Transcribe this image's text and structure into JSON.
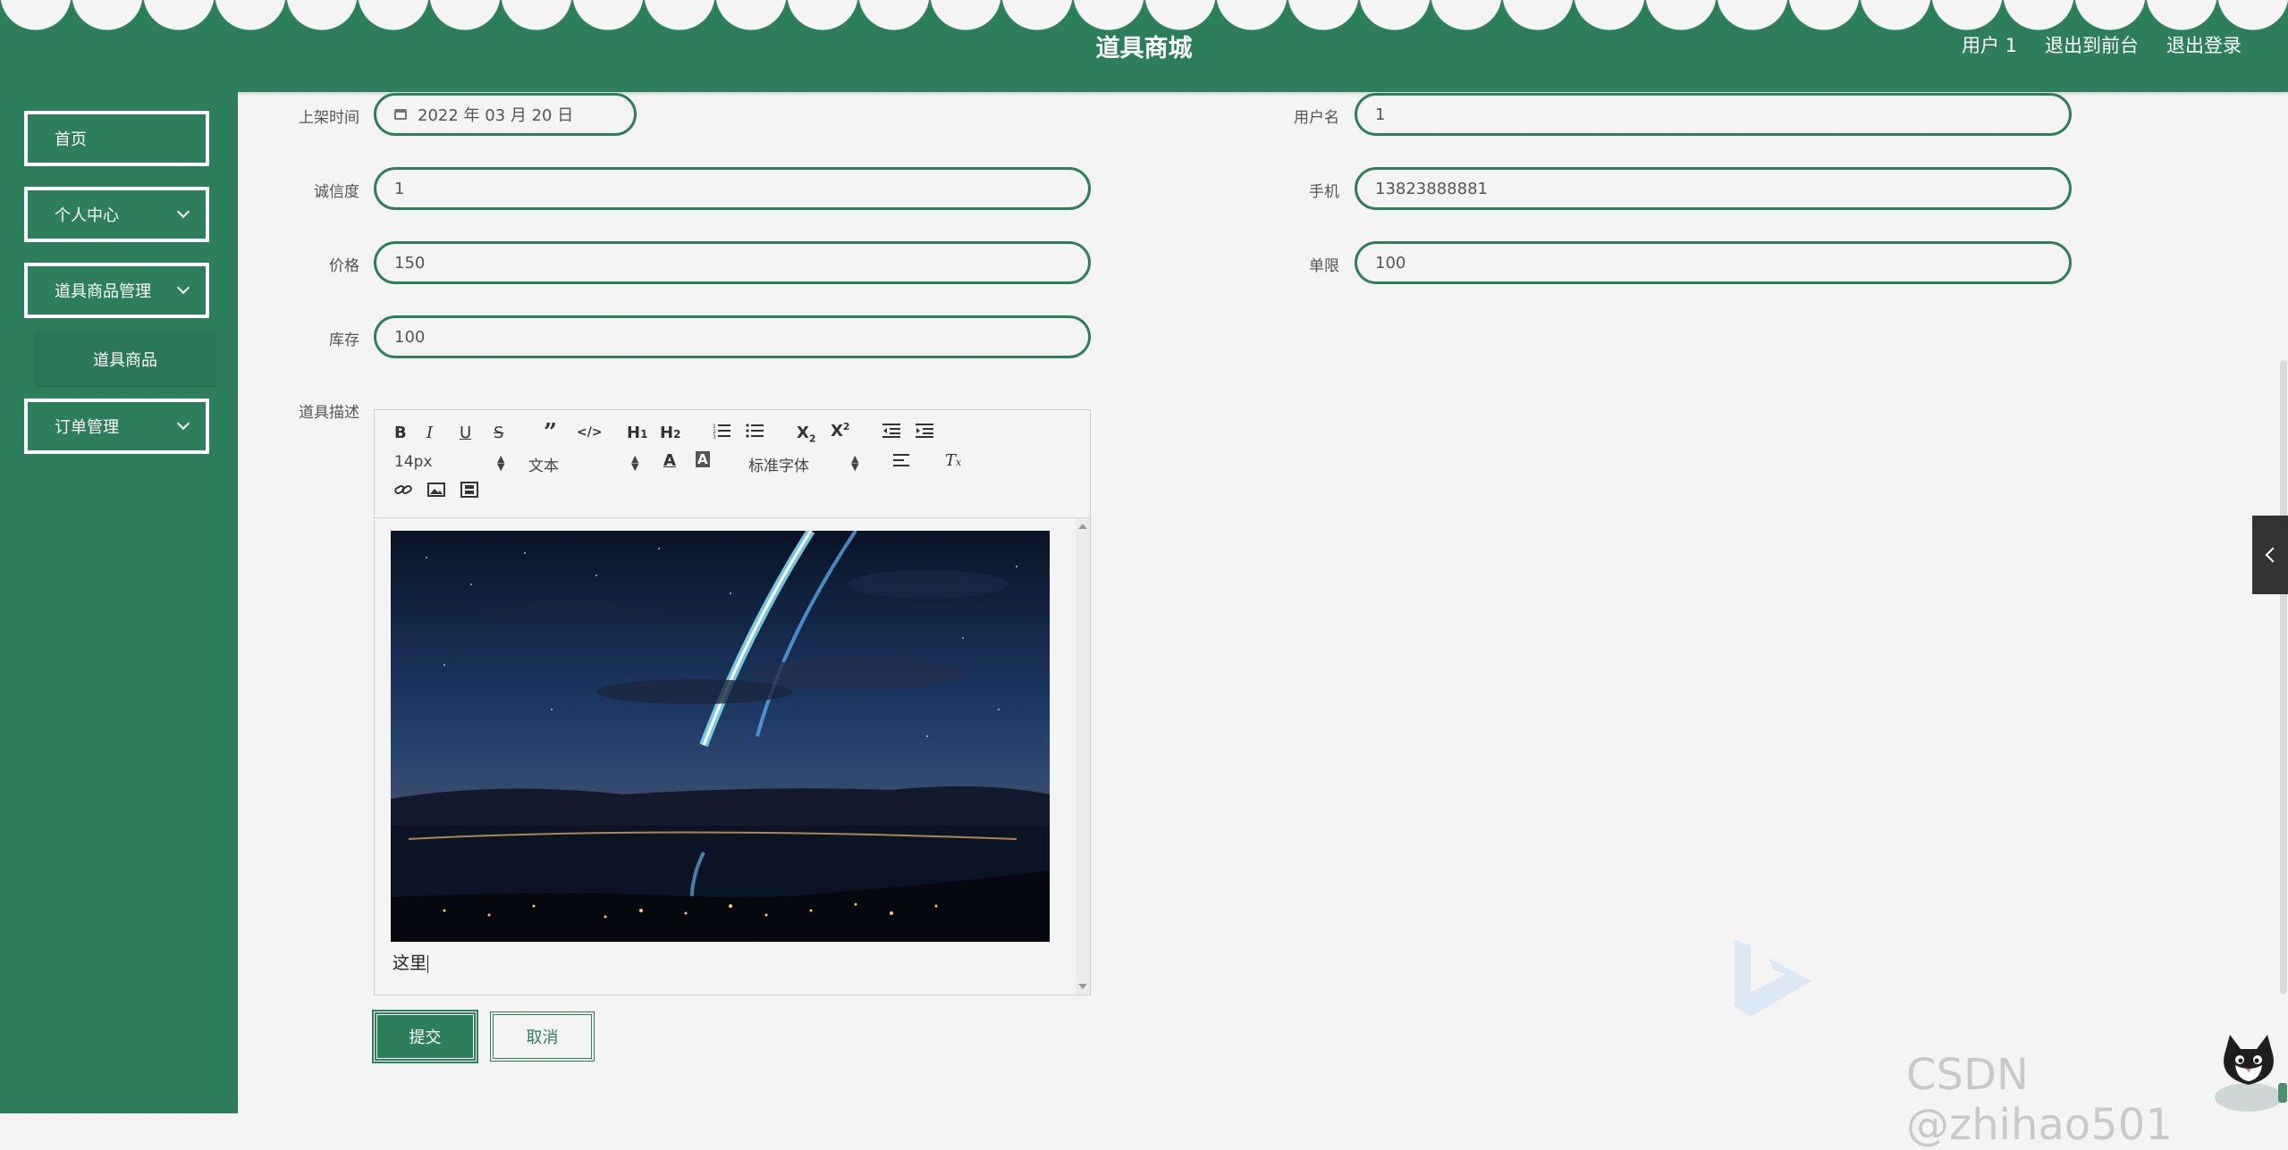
{
  "header": {
    "title": "道具商城",
    "links": {
      "user": "用户 1",
      "back_front": "退出到前台",
      "logout": "退出登录"
    }
  },
  "sidebar": {
    "items": [
      {
        "label": "首页"
      },
      {
        "label": "个人中心"
      },
      {
        "label": "道具商品管理"
      },
      {
        "label": "订单管理"
      }
    ],
    "subitem": {
      "label": "道具商品"
    }
  },
  "form": {
    "shelf_time": {
      "label": "上架时间",
      "value": "2022 年 03 月 20 日"
    },
    "username": {
      "label": "用户名",
      "value": "1"
    },
    "credit": {
      "label": "诚信度",
      "value": "1"
    },
    "phone": {
      "label": "手机",
      "value": "13823888881"
    },
    "price": {
      "label": "价格",
      "value": "150"
    },
    "limit": {
      "label": "单限",
      "value": "100"
    },
    "stock": {
      "label": "库存",
      "value": "100"
    },
    "description": {
      "label": "道具描述"
    }
  },
  "editor": {
    "font_size": "14px",
    "format": "文本",
    "font_family": "标准字体",
    "content_text": "这里"
  },
  "buttons": {
    "submit": "提交",
    "cancel": "取消"
  },
  "watermark": "CSDN @zhihao501",
  "colors": {
    "theme_green": "#2d7f5c",
    "background": "#f4f4f4"
  }
}
